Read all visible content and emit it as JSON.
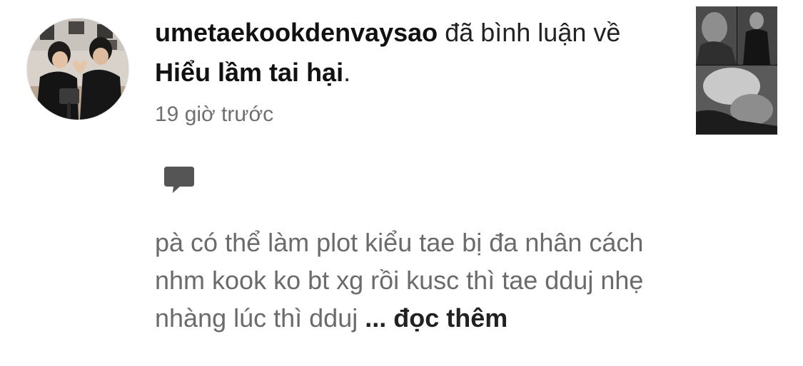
{
  "notification": {
    "username": "umetaekookdenvaysao",
    "action_text": " đã bình luận về ",
    "story_title": "Hiểu lầm tai hại",
    "title_suffix": ".",
    "timestamp": "19 giờ trước",
    "avatar_icon": "user-avatar-photo",
    "thumbnail_icon": "story-cover-thumbnail",
    "comment_icon": "comment-bubble-icon",
    "comment_text": "pà có thể làm plot kiểu tae bị đa nhân cách nhm kook ko bt xg rồi kusc thì tae dduj nhẹ nhàng lúc thì dduj ",
    "read_more_label": "... đọc thêm",
    "colors": {
      "text_primary": "#111111",
      "text_secondary": "#6f6f6f",
      "comment_text": "#6b6b6b",
      "icon_gray": "#555555",
      "background": "#ffffff"
    }
  }
}
